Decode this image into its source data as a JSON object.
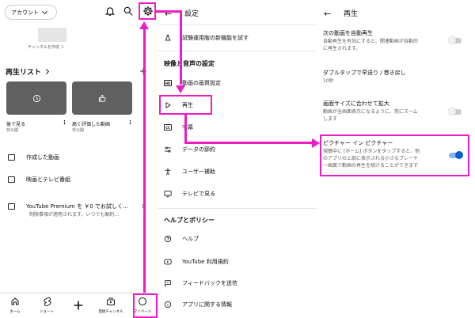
{
  "panel1": {
    "account_label": "アカウント",
    "channel_create": "チャンネルを作成 ＞",
    "playlist_title": "再生リスト",
    "plus": "+",
    "cards": [
      {
        "title": "後で見る",
        "sub": "非公開"
      },
      {
        "title": "高く評価した動画",
        "sub": "非公開"
      }
    ],
    "kebab": "⋮",
    "menu": [
      {
        "label": "作成した動画"
      },
      {
        "label": "映画とテレビ番組"
      }
    ],
    "premium_title": "YouTube Premium を ￥0 でお試しく…",
    "premium_sub": "制限事項が適用されます。いつでも解約…",
    "close": "✕",
    "nav": [
      {
        "label": "ホーム"
      },
      {
        "label": "ショート"
      },
      {
        "label": ""
      },
      {
        "label": "登録チャンネル"
      },
      {
        "label": "マイページ"
      }
    ]
  },
  "panel2": {
    "title": "設定",
    "back": "←",
    "trial": "試験運用版の新機能を試す",
    "section1": "映像と音声の設定",
    "items1": [
      {
        "label": "動画の画質設定"
      },
      {
        "label": "再生"
      },
      {
        "label": "字幕"
      },
      {
        "label": "データの節約"
      },
      {
        "label": "ユーザー補助"
      },
      {
        "label": "テレビで見る"
      }
    ],
    "hd_text": "HD",
    "cc_text": "CC",
    "section2": "ヘルプとポリシー",
    "items2": [
      {
        "label": "ヘルプ"
      },
      {
        "label": "YouTube 利用規約"
      },
      {
        "label": "フィードバックを送信"
      },
      {
        "label": "アプリに関する情報"
      }
    ]
  },
  "panel3": {
    "title": "再生",
    "back": "←",
    "settings": [
      {
        "title": "次の動画を自動再生",
        "desc": [
          "自動再生を有効にすると、関連動画が自動的",
          "に再生されます。"
        ],
        "toggle": false
      },
      {
        "title": "ダブルタップで早送り / 巻き戻し",
        "desc": [
          "10秒"
        ]
      },
      {
        "title": "画面サイズに合わせて拡大",
        "desc": [
          "動画が全画面表示になるように、常にズーム",
          "します"
        ],
        "toggle": false
      },
      {
        "title": "ピクチャー イン ピクチャー",
        "desc": [
          "視聴中に [ホーム] ボタンをタップすると、他",
          "のアプリの上部に表示される小さなプレーヤ",
          "ー画面で動画の再生を続けることができます"
        ],
        "toggle": true
      }
    ]
  },
  "colors": {
    "annotation": "#ee1cc5",
    "toggle_on": "#065fd4",
    "thumb": "#606060"
  }
}
